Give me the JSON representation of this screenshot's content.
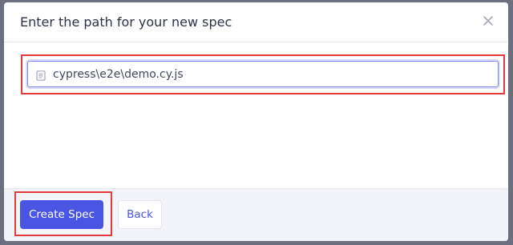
{
  "dialog": {
    "title": "Enter the path for your new spec",
    "close_icon": "close-icon"
  },
  "spec_path": {
    "value": "cypress\\e2e\\demo.cy.js",
    "icon": "file-icon"
  },
  "footer": {
    "create_label": "Create Spec",
    "back_label": "Back"
  },
  "colors": {
    "accent": "#4956e3",
    "highlight": "#e23a3a",
    "backdrop": "#6b6f7e"
  }
}
